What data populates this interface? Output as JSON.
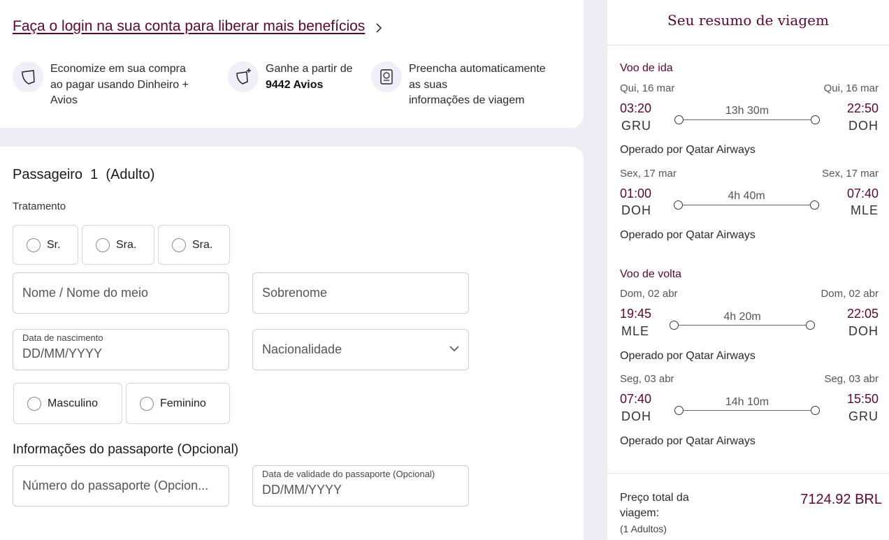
{
  "login": {
    "link": "Faça o login na sua conta para liberar mais benefícios",
    "benefits": [
      {
        "icon": "avios-shape-icon",
        "line1": "Economize em sua compra",
        "line2": "ao pagar usando Dinheiro +",
        "line3": "Avios"
      },
      {
        "icon": "avios-plus-icon",
        "line1": "Ganhe a partir de",
        "bold": "9442 Avios"
      },
      {
        "icon": "passport-icon",
        "line1": "Preencha automaticamente",
        "line2": "as suas",
        "line3": "informações de viagem"
      }
    ]
  },
  "passenger": {
    "title": "Passageiro  1  (Adulto)",
    "treatment_label": "Tratamento",
    "titles": [
      "Sr.",
      "Sra.",
      "Sra."
    ],
    "first_name_placeholder": "Nome / Nome do meio",
    "last_name_placeholder": "Sobrenome",
    "dob_label": "Data de nascimento",
    "dob_placeholder": "DD/MM/YYYY",
    "nationality_placeholder": "Nacionalidade",
    "genders": [
      "Masculino",
      "Feminino"
    ],
    "passport_section": "Informações do passaporte (Opcional)",
    "passport_number_placeholder": "Número do passaporte (Opcion...",
    "passport_expiry_label": "Data de validade do passaporte (Opcional)",
    "passport_expiry_placeholder": "DD/MM/YYYY"
  },
  "summary": {
    "title": "Seu resumo de viagem",
    "outbound_label": "Voo de ida",
    "return_label": "Voo de volta",
    "segments": [
      {
        "dep_date": "Qui, 16 mar",
        "arr_date": "Qui, 16 mar",
        "dep_time": "03:20",
        "arr_time": "22:50",
        "dep_airport": "GRU",
        "arr_airport": "DOH",
        "duration": "13h 30m",
        "operated": "Operado por Qatar Airways"
      },
      {
        "dep_date": "Sex, 17 mar",
        "arr_date": "Sex, 17 mar",
        "dep_time": "01:00",
        "arr_time": "07:40",
        "dep_airport": "DOH",
        "arr_airport": "MLE",
        "duration": "4h 40m",
        "operated": "Operado por Qatar Airways"
      },
      {
        "dep_date": "Dom, 02 abr",
        "arr_date": "Dom, 02 abr",
        "dep_time": "19:45",
        "arr_time": "22:05",
        "dep_airport": "MLE",
        "arr_airport": "DOH",
        "duration": "4h 20m",
        "operated": "Operado por Qatar Airways"
      },
      {
        "dep_date": "Seg, 03 abr",
        "arr_date": "Seg, 03 abr",
        "dep_time": "07:40",
        "arr_time": "15:50",
        "dep_airport": "DOH",
        "arr_airport": "GRU",
        "duration": "14h 10m",
        "operated": "Operado por Qatar Airways"
      }
    ],
    "total_label_1": "Preço total da",
    "total_label_2": "viagem:",
    "total_sub": "(1 Adultos)",
    "total_price": "7124.92 BRL"
  },
  "colors": {
    "brand": "#5c0632",
    "background": "#eeedf5"
  }
}
